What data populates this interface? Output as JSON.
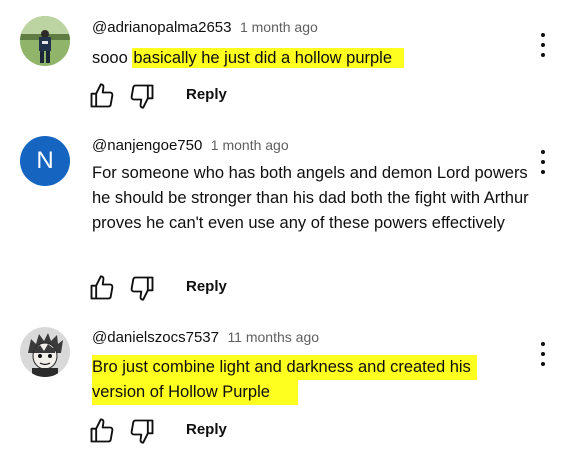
{
  "comments": [
    {
      "handle": "@adrianopalma2653",
      "time": "1 month ago",
      "text_plain": "sooo ",
      "text_highlight": "basically he just did a hollow purple",
      "reply_label": "Reply",
      "avatar": "photo"
    },
    {
      "handle": "@nanjengoe750",
      "time": "1 month ago",
      "text": "For someone who has both angels and demon Lord powers he should be stronger than his dad both the fight with Arthur proves he can't even use any of these powers effectively",
      "reply_label": "Reply",
      "avatar_letter": "N",
      "avatar_color": "#1565c0"
    },
    {
      "handle": "@danielszocs7537",
      "time": "11 months ago",
      "text_highlight_line1": "Bro just combine light and darkness and created his",
      "text_highlight_line2": "version of Hollow Purple",
      "reply_label": "Reply",
      "avatar": "anime-character"
    }
  ],
  "colors": {
    "highlight": "#ffff1f",
    "text": "#0f0f0f",
    "secondary": "#606060"
  },
  "icons": [
    "like-icon",
    "dislike-icon",
    "more-options-icon"
  ]
}
